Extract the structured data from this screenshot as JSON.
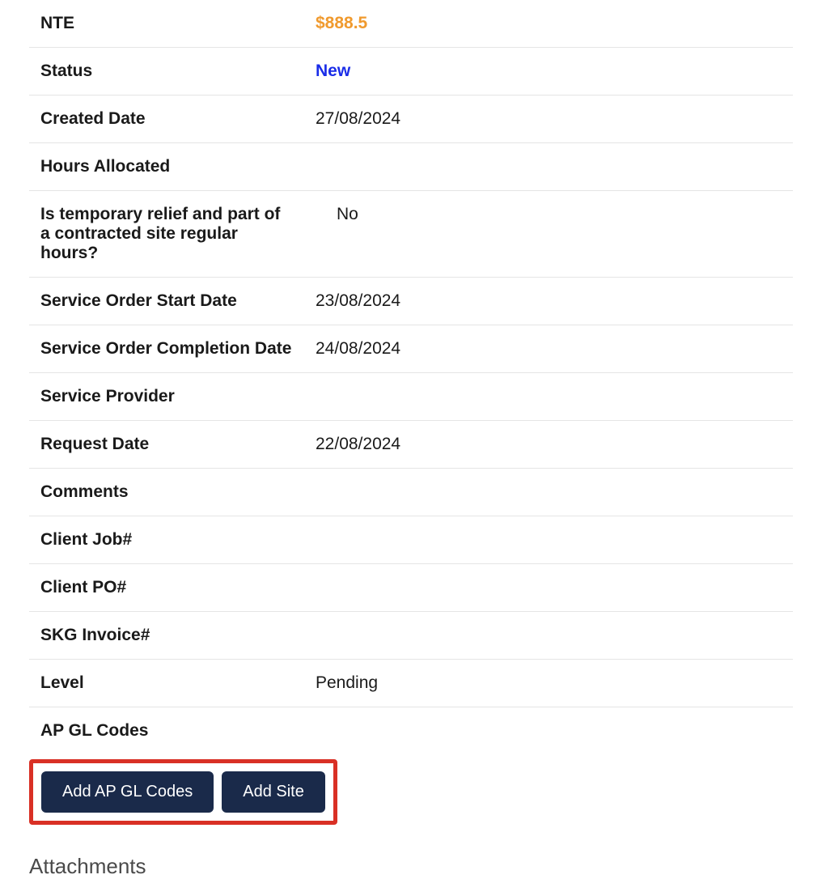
{
  "details": {
    "nte": {
      "label": "NTE",
      "value": "$888.5"
    },
    "status": {
      "label": "Status",
      "value": "New"
    },
    "createdDate": {
      "label": "Created Date",
      "value": "27/08/2024"
    },
    "hoursAllocated": {
      "label": "Hours Allocated",
      "value": ""
    },
    "tempRelief": {
      "label": "Is temporary relief and part of a contracted site regular hours?",
      "value": "No"
    },
    "startDate": {
      "label": "Service Order Start Date",
      "value": "23/08/2024"
    },
    "completionDate": {
      "label": "Service Order Completion Date",
      "value": "24/08/2024"
    },
    "serviceProvider": {
      "label": "Service Provider",
      "value": ""
    },
    "requestDate": {
      "label": "Request Date",
      "value": "22/08/2024"
    },
    "comments": {
      "label": "Comments",
      "value": ""
    },
    "clientJob": {
      "label": "Client Job#",
      "value": ""
    },
    "clientPO": {
      "label": "Client PO#",
      "value": ""
    },
    "skgInvoice": {
      "label": "SKG Invoice#",
      "value": ""
    },
    "level": {
      "label": "Level",
      "value": "Pending"
    },
    "apGlCodes": {
      "label": "AP GL Codes",
      "value": ""
    }
  },
  "buttons": {
    "addGlCodes": "Add AP GL Codes",
    "addSite": "Add Site"
  },
  "sections": {
    "attachments": "Attachments"
  }
}
